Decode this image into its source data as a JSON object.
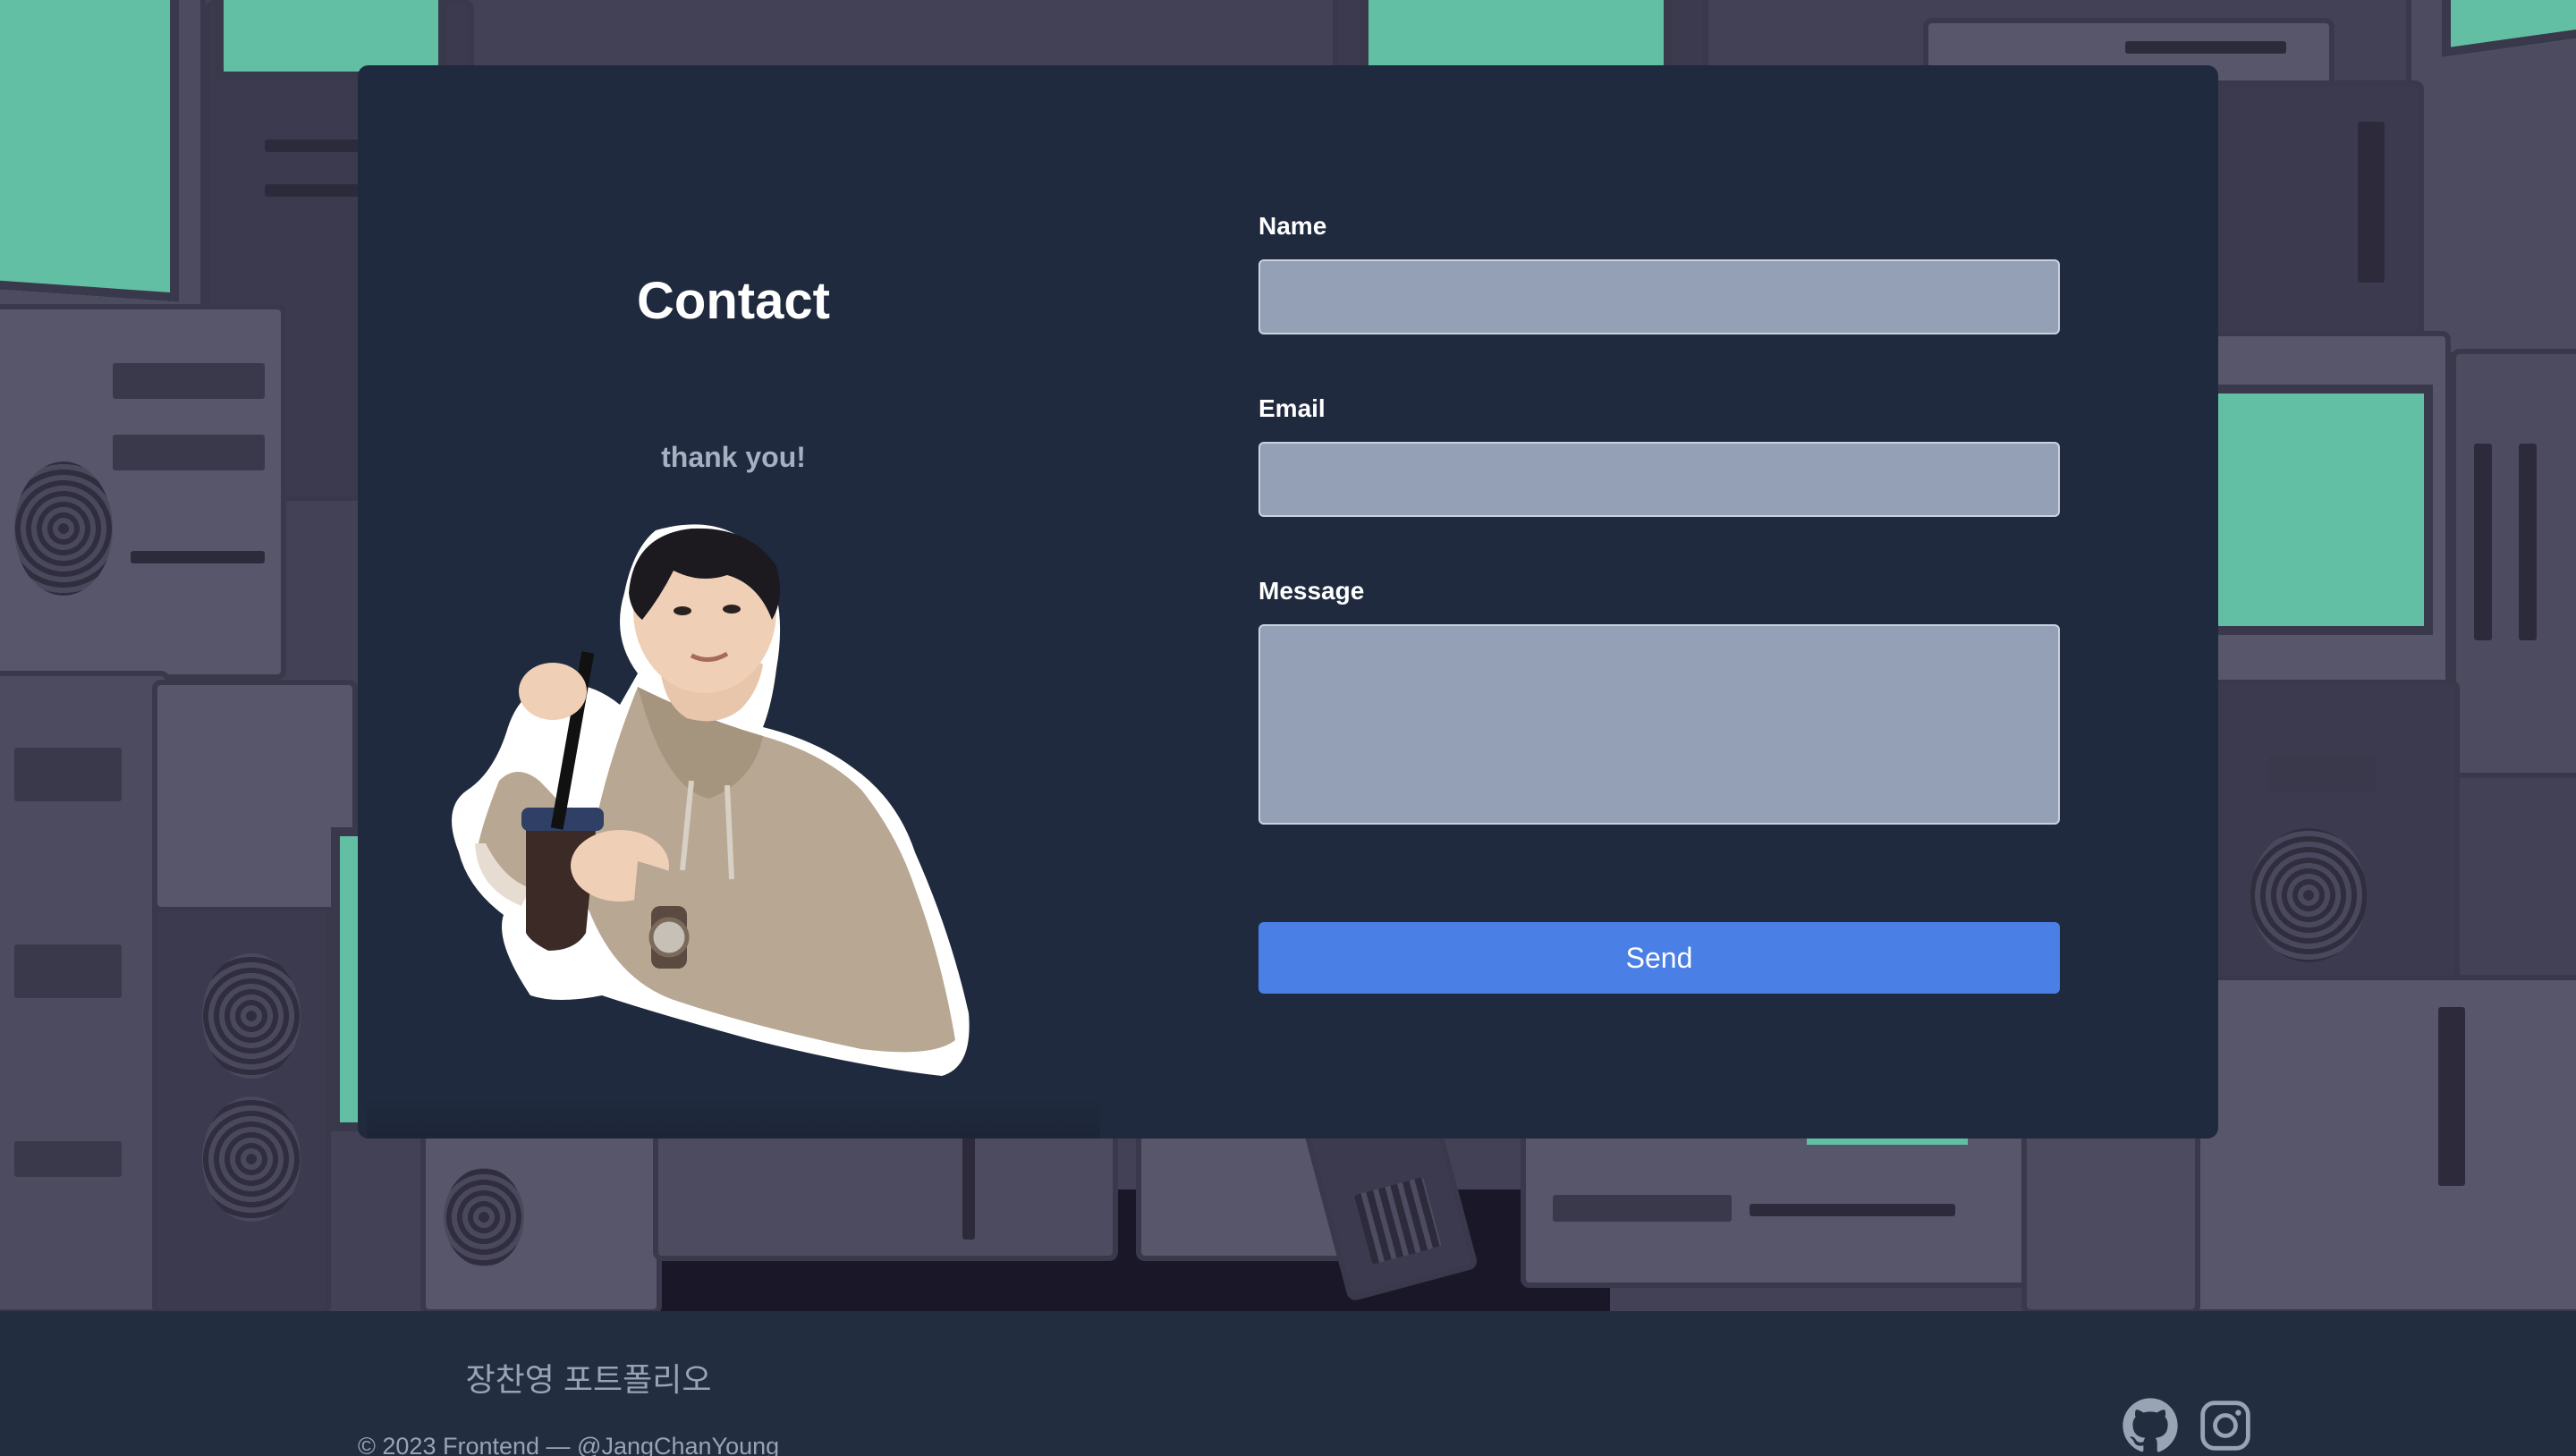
{
  "contact": {
    "title": "Contact",
    "subtitle": "thank you!"
  },
  "form": {
    "name_label": "Name",
    "name_value": "",
    "email_label": "Email",
    "email_value": "",
    "message_label": "Message",
    "message_value": "",
    "send_label": "Send"
  },
  "footer": {
    "title": "장찬영 포트폴리오",
    "copyright": "© 2023 Frontend — @JangChanYoung",
    "social_icons": [
      "github-icon",
      "instagram-icon"
    ]
  },
  "colors": {
    "card_background": "#1f2a3e",
    "input_background": "#94a0b6",
    "button_accent": "#4a7fe6",
    "screen_green": "#62bfa3",
    "footer_background": "#222d40"
  }
}
